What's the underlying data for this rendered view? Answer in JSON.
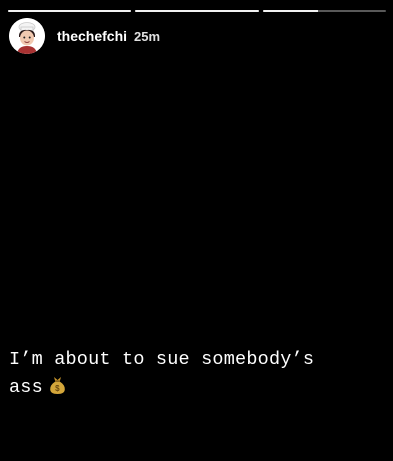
{
  "story": {
    "progress": [
      1,
      1,
      0.45
    ],
    "user": {
      "username": "thechefchi",
      "time_ago": "25m",
      "avatar_icon": "cartoon-chef-avatar-icon"
    },
    "caption": {
      "line1": "I’m about to sue somebody’s",
      "line2": "ass",
      "emoji_icon": "money-bag-icon"
    }
  },
  "colors": {
    "background": "#000000",
    "text": "#ffffff",
    "money_bag": "#d4a63a"
  }
}
